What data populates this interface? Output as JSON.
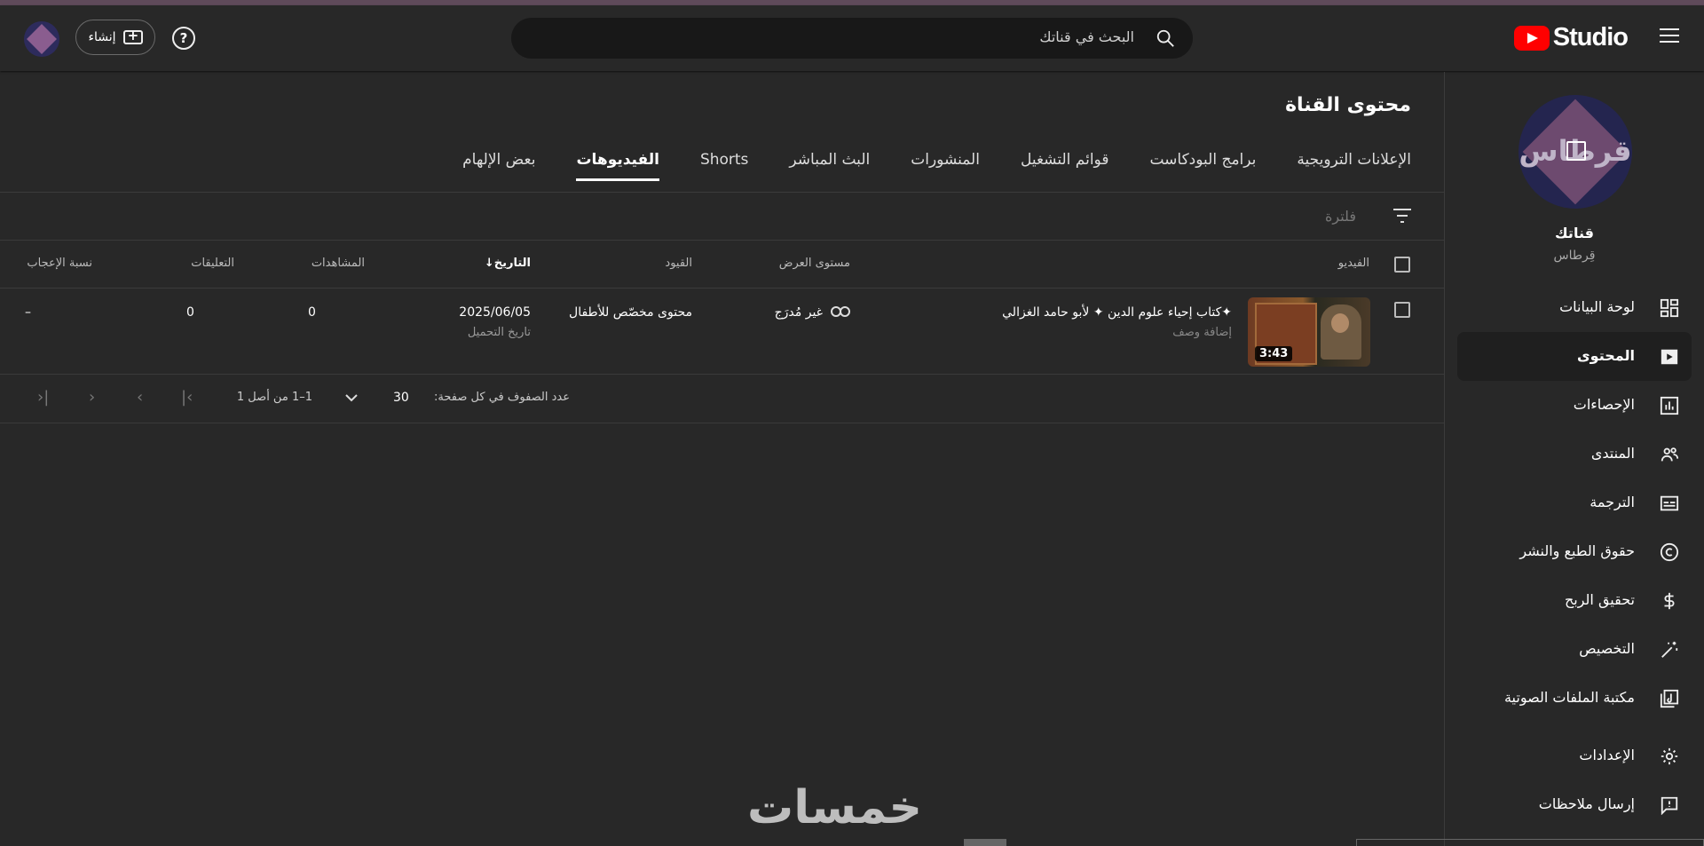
{
  "header": {
    "app_name": "Studio",
    "search_placeholder": "البحث في قناتك",
    "create_label": "إنشاء",
    "help_glyph": "?"
  },
  "sidebar": {
    "channel_title": "قناتك",
    "channel_name": "قِرطاس",
    "avatar_text": "قرطاس",
    "items": [
      {
        "label": "لوحة البيانات",
        "icon": "dashboard-icon"
      },
      {
        "label": "المحتوى",
        "icon": "content-icon",
        "active": true
      },
      {
        "label": "الإحصاءات",
        "icon": "analytics-icon"
      },
      {
        "label": "المنتدى",
        "icon": "community-icon"
      },
      {
        "label": "الترجمة",
        "icon": "subtitles-icon"
      },
      {
        "label": "حقوق الطبع والنشر",
        "icon": "copyright-icon"
      },
      {
        "label": "تحقيق الربح",
        "icon": "monetization-icon"
      },
      {
        "label": "التخصيص",
        "icon": "customization-icon"
      },
      {
        "label": "مكتبة الملفات الصوتية",
        "icon": "audio-library-icon"
      },
      {
        "label": "الإعدادات",
        "icon": "settings-icon"
      },
      {
        "label": "إرسال ملاحظات",
        "icon": "feedback-icon"
      }
    ]
  },
  "main": {
    "title": "محتوى القناة",
    "tabs": [
      {
        "label": "بعض الإلهام"
      },
      {
        "label": "الفيديوهات",
        "active": true
      },
      {
        "label": "Shorts"
      },
      {
        "label": "البث المباشر"
      },
      {
        "label": "المنشورات"
      },
      {
        "label": "قوائم التشغيل"
      },
      {
        "label": "برامج البودكاست"
      },
      {
        "label": "الإعلانات الترويجية"
      }
    ],
    "filter_placeholder": "فلترة",
    "columns": {
      "video": "الفيديو",
      "visibility": "مستوى العرض",
      "restrictions": "القيود",
      "date": "التاريخ",
      "views": "المشاهدات",
      "comments": "التعليقات",
      "likes": "نسبة الإعجاب"
    },
    "rows": [
      {
        "title": "✦كتاب إحياء علوم الدين ✦ لأبو حامد الغزالي",
        "description": "إضافة وصف",
        "duration": "3:43",
        "visibility": "غير مُدرَج",
        "restrictions": "محتوى مخصّص للأطفال",
        "date": "2025/06/05",
        "date_type": "تاريخ التحميل",
        "views": "0",
        "comments": "0",
        "likes": "–"
      }
    ],
    "pagination": {
      "rows_per_page_label": "عدد الصفوف في كل صفحة:",
      "rows_per_page": "30",
      "range": "1–1 من أصل 1"
    }
  },
  "watermark": "خمسات"
}
